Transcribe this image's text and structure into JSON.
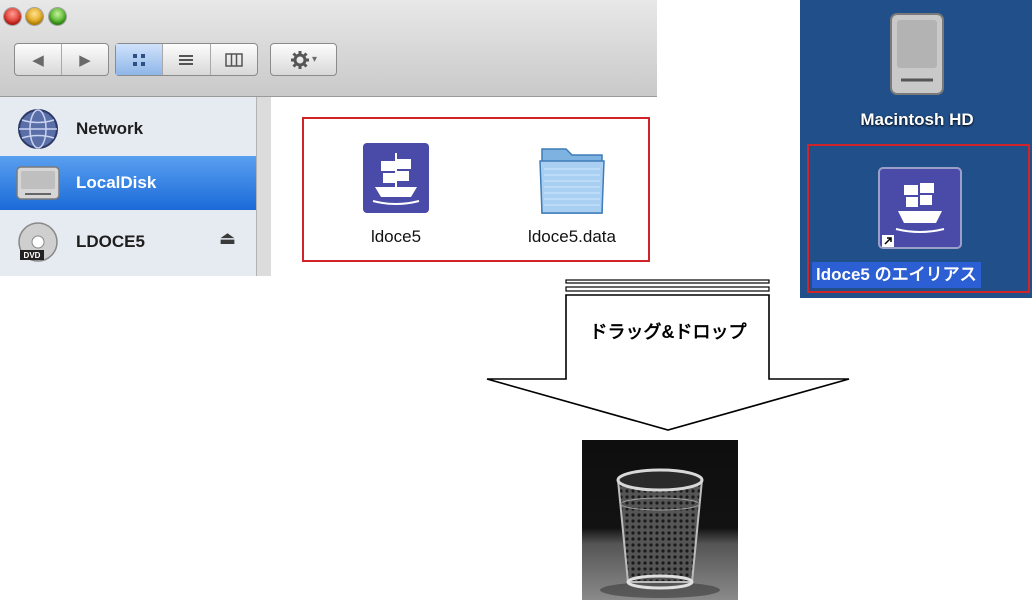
{
  "finder": {
    "sidebar": {
      "items": [
        {
          "label": "Network",
          "icon": "network-globe-icon"
        },
        {
          "label": "LocalDisk",
          "icon": "hard-disk-icon",
          "selected": true
        },
        {
          "label": "LDOCE5",
          "icon": "dvd-disc-icon",
          "eject": "⏏"
        }
      ]
    },
    "files": [
      {
        "label": "ldoce5",
        "icon": "ldoce-ship-app-icon"
      },
      {
        "label": "ldoce5.data",
        "icon": "folder-icon"
      }
    ]
  },
  "desktop": {
    "hd_label": "Macintosh HD",
    "alias_label": "ldoce5 のエイリアス"
  },
  "arrow_label": "ドラッグ&ドロップ",
  "colors": {
    "highlight_border": "#d0232a",
    "desktop_bg": "#214f8a",
    "selection_blue": "#1a6ad8"
  }
}
